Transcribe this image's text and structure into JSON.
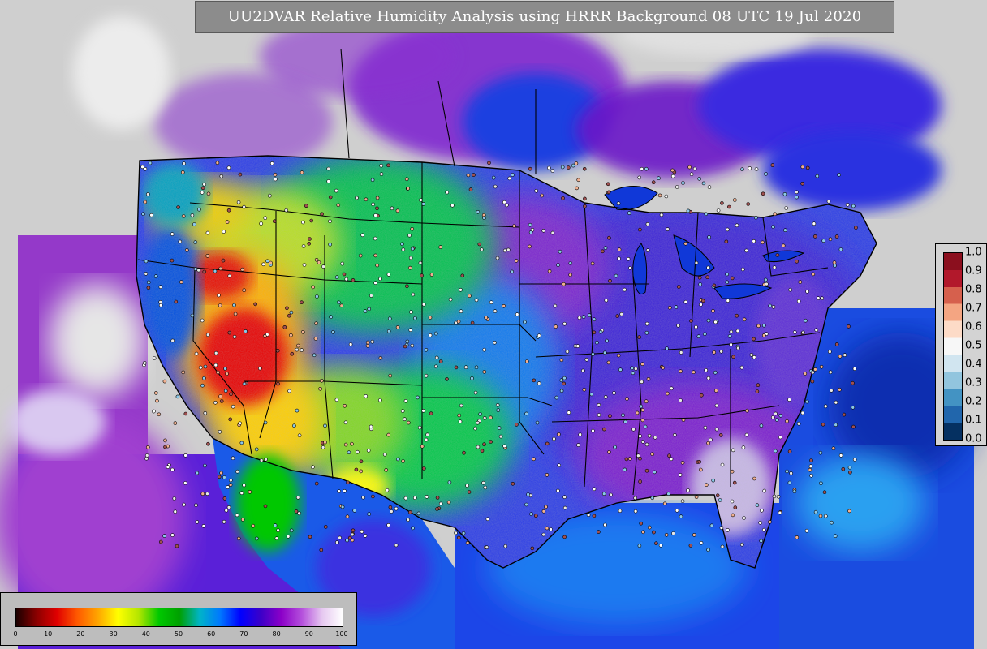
{
  "title": "UU2DVAR Relative Humidity Analysis using HRRR Background 08 UTC 19 Jul 2020",
  "colors": {
    "land_no_data": "#cfcfcf",
    "ocean": "#1e4fe0",
    "boundary": "#000000",
    "legend_bg": "#bdbdbd",
    "title_bg": "#8c8c8c"
  },
  "rh_legend": {
    "ticks": [
      "0",
      "10",
      "20",
      "30",
      "40",
      "50",
      "60",
      "70",
      "80",
      "90",
      "100"
    ],
    "stops": [
      "#1a0000",
      "#8b0000",
      "#e00000",
      "#ff5a00",
      "#ffa500",
      "#ffff00",
      "#b4e600",
      "#00c800",
      "#00a000",
      "#00b4c8",
      "#0078ff",
      "#0000ff",
      "#3c00c8",
      "#8c00c8",
      "#b450dc",
      "#e6c8f0",
      "#ffffff"
    ]
  },
  "std_legend": {
    "ticks": [
      "1.0",
      "0.9",
      "0.8",
      "0.7",
      "0.6",
      "0.5",
      "0.4",
      "0.3",
      "0.2",
      "0.1",
      "0.0"
    ],
    "colors": [
      "#8b0f1e",
      "#b2182b",
      "#d6604d",
      "#f4a582",
      "#fddbc7",
      "#f7f7f7",
      "#d1e5f0",
      "#92c5de",
      "#4393c3",
      "#2166ac",
      "#053061"
    ]
  }
}
